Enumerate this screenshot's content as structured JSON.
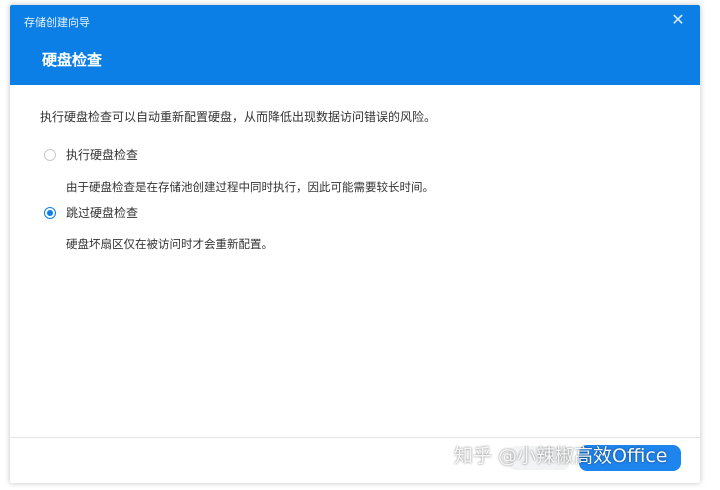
{
  "window": {
    "title": "存储创建向导",
    "close_icon": "close-icon"
  },
  "header": {
    "title": "硬盘检查"
  },
  "content": {
    "intro": "执行硬盘检查可以自动重新配置硬盘，从而降低出现数据访问错误的风险。",
    "options": [
      {
        "label": "执行硬盘检查",
        "description": "由于硬盘检查是在存储池创建过程中同时执行，因此可能需要较长时间。",
        "selected": false
      },
      {
        "label": "跳过硬盘检查",
        "description": "硬盘坏扇区仅在被访问时才会重新配置。",
        "selected": true
      }
    ]
  },
  "watermark": "知乎 @小辣椒高效Office",
  "colors": {
    "accent": "#0b7fe6"
  }
}
